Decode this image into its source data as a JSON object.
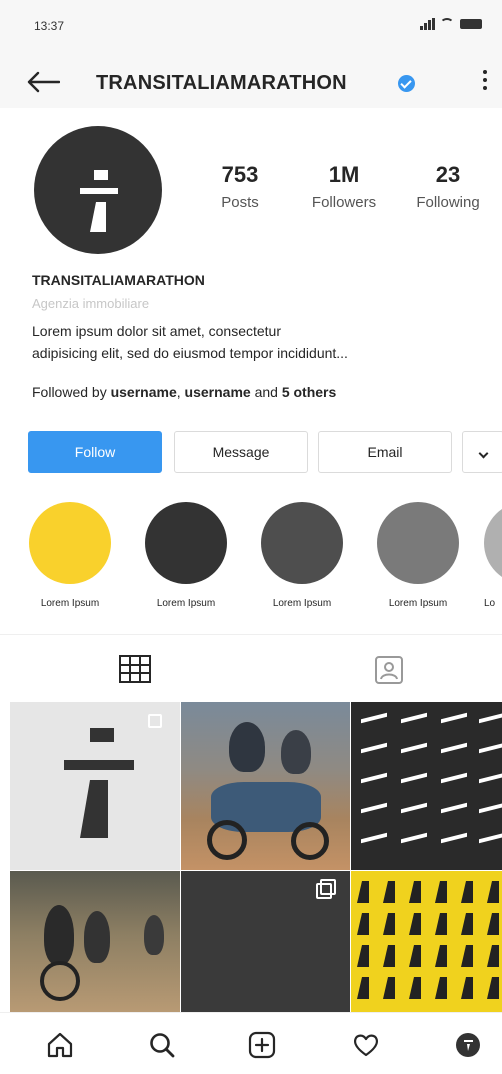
{
  "status_bar": {
    "time": "13:37"
  },
  "header": {
    "title": "TRANSITALIAMARATHON"
  },
  "profile": {
    "stats": [
      {
        "value": "753",
        "label": "Posts"
      },
      {
        "value": "1M",
        "label": "Followers"
      },
      {
        "value": "23",
        "label": "Following"
      }
    ],
    "name": "TRANSITALIAMARATHON",
    "category": "Agenzia immobiliare",
    "bio_line_1": "Lorem ipsum dolor sit amet, consectetur",
    "bio_line_2": "adipisicing elit, sed do eiusmod tempor incididunt...",
    "followed_prefix": "Followed by",
    "followed_user_1": "username",
    "followed_sep": ",",
    "followed_user_2": "username",
    "followed_and": "and",
    "followed_others": "5 others"
  },
  "actions": {
    "follow_label": "Follow",
    "message_label": "Message",
    "email_label": "Email"
  },
  "highlights": [
    {
      "label": "Lorem Ipsum",
      "color": "#f9d12c"
    },
    {
      "label": "Lorem Ipsum",
      "color": "#333333"
    },
    {
      "label": "Lorem Ipsum",
      "color": "#4e4e4e"
    },
    {
      "label": "Lorem Ipsum",
      "color": "#7a7a7a"
    },
    {
      "label": "Lo",
      "color": "#b0b0b0"
    }
  ],
  "tabs": {
    "grid_icon": "grid-icon",
    "tagged_icon": "tagged-person-icon"
  },
  "grid": [
    {
      "kind": "logo-7",
      "multiple": true
    },
    {
      "kind": "photo-motorcycle",
      "multiple": false
    },
    {
      "kind": "pattern-dark",
      "multiple": false
    },
    {
      "kind": "photo-riders",
      "multiple": false
    },
    {
      "kind": "plain-dark",
      "multiple": true
    },
    {
      "kind": "pattern-yellow",
      "multiple": false
    }
  ],
  "colors": {
    "accent": "#3897f0",
    "text": "#262626",
    "muted": "#c7c7c7"
  },
  "bottom_nav": [
    "home-icon",
    "search-icon",
    "add-icon",
    "heart-icon",
    "profile-icon"
  ]
}
